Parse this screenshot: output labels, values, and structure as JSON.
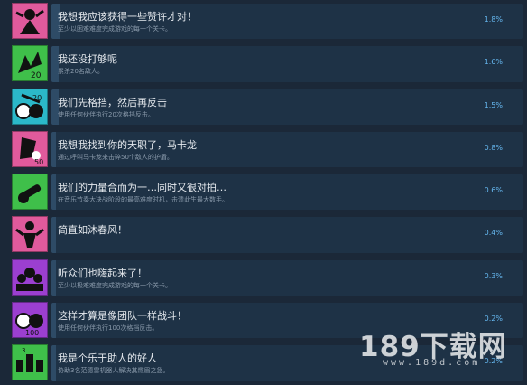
{
  "achievements": [
    {
      "title": "我想我应该获得一些赞许才对！",
      "desc": "至少以困难难度完成游戏的每一个关卡。",
      "percent": "1.8%",
      "ratio": 0.018,
      "icon": "robot-dancer-icon",
      "color": "#e05a9c"
    },
    {
      "title": "我还没打够呢",
      "desc": "累杀20名敌人。",
      "percent": "1.6%",
      "ratio": 0.016,
      "icon": "combo-20-icon",
      "color": "#3fbf4a"
    },
    {
      "title": "我们先格挡，然后再反击",
      "desc": "使用任何伙伴执行20次格挡反击。",
      "percent": "1.5%",
      "ratio": 0.015,
      "icon": "parry-20-icon",
      "color": "#2bb8c9"
    },
    {
      "title": "我想我找到你的天职了，马卡龙",
      "desc": "通过呼叫马卡龙来击碎50个敌人的护盾。",
      "percent": "0.8%",
      "ratio": 0.008,
      "icon": "shield-break-50-icon",
      "color": "#e05a9c"
    },
    {
      "title": "我们的力量合而为一…同时又很对拍…",
      "desc": "在音乐节奏大决战阶段的最高难度时机，击溃此生最大数手。",
      "percent": "0.6%",
      "ratio": 0.006,
      "icon": "guitar-icon",
      "color": "#3fbf4a"
    },
    {
      "title": "简直如沐春风！",
      "desc": "",
      "percent": "0.4%",
      "ratio": 0.004,
      "icon": "spring-character-icon",
      "color": "#e05a9c"
    },
    {
      "title": "听众们也嗨起来了！",
      "desc": "至少以极难难度完成游戏的每一个关卡。",
      "percent": "0.3%",
      "ratio": 0.003,
      "icon": "crowd-icon",
      "color": "#9b3fd0"
    },
    {
      "title": "这样才算是像团队一样战斗！",
      "desc": "使用任何伙伴执行100次格挡反击。",
      "percent": "0.2%",
      "ratio": 0.002,
      "icon": "parry-100-icon",
      "color": "#9b3fd0"
    },
    {
      "title": "我是个乐于助人的好人",
      "desc": "协助3名范德雷机器人解决其燃眉之急。",
      "percent": "0.2%",
      "ratio": 0.002,
      "icon": "helper-robots-icon",
      "color": "#3fbf4a"
    }
  ],
  "watermark": {
    "logo": "189下载网",
    "url": "www.189d.com"
  }
}
